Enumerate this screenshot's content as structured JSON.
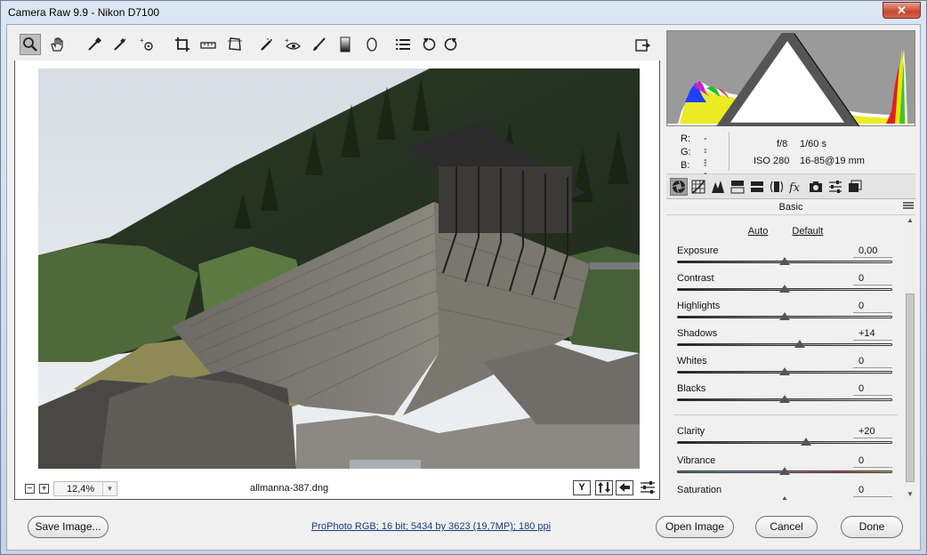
{
  "window": {
    "title": "Camera Raw 9.9  -  Nikon D7100",
    "close_glyph": "✕"
  },
  "toolbar": {
    "tools": [
      {
        "name": "zoom-tool",
        "icon": "magnifier-icon",
        "active": true
      },
      {
        "name": "hand-tool",
        "icon": "hand-icon"
      },
      {
        "name": "white-balance-tool",
        "icon": "eyedropper-icon"
      },
      {
        "name": "color-sampler-tool",
        "icon": "color-sampler-icon"
      },
      {
        "name": "targeted-adjustment-tool",
        "icon": "targeted-adjustment-icon"
      },
      {
        "name": "crop-tool",
        "icon": "crop-icon"
      },
      {
        "name": "straighten-tool",
        "icon": "level-icon"
      },
      {
        "name": "transform-tool",
        "icon": "transform-icon"
      },
      {
        "name": "spot-removal-tool",
        "icon": "spot-removal-icon"
      },
      {
        "name": "red-eye-tool",
        "icon": "red-eye-icon"
      },
      {
        "name": "adjustment-brush-tool",
        "icon": "brush-icon"
      },
      {
        "name": "graduated-filter-tool",
        "icon": "gradient-icon"
      },
      {
        "name": "radial-filter-tool",
        "icon": "ellipse-icon"
      },
      {
        "name": "preferences-button",
        "icon": "list-icon"
      },
      {
        "name": "rotate-left-button",
        "icon": "rotate-ccw-icon"
      },
      {
        "name": "rotate-right-button",
        "icon": "rotate-cw-icon"
      },
      {
        "name": "toggle-fullscreen-button",
        "icon": "fullscreen-icon"
      }
    ]
  },
  "status": {
    "zoom_minus": "−",
    "zoom_plus": "+",
    "zoom_value": "12,4%",
    "filename": "allmanna-387.dng",
    "y_label": "Y",
    "buttons": [
      "before-after-icon",
      "swap-icon",
      "copy-settings-icon",
      "settings-icon"
    ]
  },
  "histogram": {
    "shadow_clip_icon": "shadow-clipping-icon",
    "highlight_clip_icon": "highlight-clipping-icon"
  },
  "camera_info": {
    "r_label": "R:",
    "r_value": "---",
    "g_label": "G:",
    "g_value": "---",
    "b_label": "B:",
    "b_value": "---",
    "aperture": "f/8",
    "shutter": "1/60 s",
    "iso": "ISO 280",
    "lens": "16-85@19 mm"
  },
  "panel_tabs": [
    "basic-icon",
    "tone-curve-icon",
    "detail-icon",
    "hsl-icon",
    "split-toning-icon",
    "lens-corrections-icon",
    "effects-icon",
    "camera-calibration-icon",
    "presets-icon",
    "snapshots-icon"
  ],
  "panel": {
    "title": "Basic",
    "auto": "Auto",
    "default": "Default",
    "sliders": [
      {
        "label": "Exposure",
        "value": "0,00",
        "pos": 0.5
      },
      {
        "label": "Contrast",
        "value": "0",
        "pos": 0.5
      },
      {
        "label": "Highlights",
        "value": "0",
        "pos": 0.5
      },
      {
        "label": "Shadows",
        "value": "+14",
        "pos": 0.57
      },
      {
        "label": "Whites",
        "value": "0",
        "pos": 0.5
      },
      {
        "label": "Blacks",
        "value": "0",
        "pos": 0.5
      },
      {
        "label": "Clarity",
        "value": "+20",
        "pos": 0.6
      },
      {
        "label": "Vibrance",
        "value": "0",
        "pos": 0.5
      },
      {
        "label": "Saturation",
        "value": "0",
        "pos": 0.5
      }
    ]
  },
  "bottom": {
    "save": "Save Image...",
    "workflow": "ProPhoto RGB; 16 bit; 5434 by 3623 (19,7MP); 180 ppi",
    "open": "Open Image",
    "cancel": "Cancel",
    "done": "Done"
  }
}
